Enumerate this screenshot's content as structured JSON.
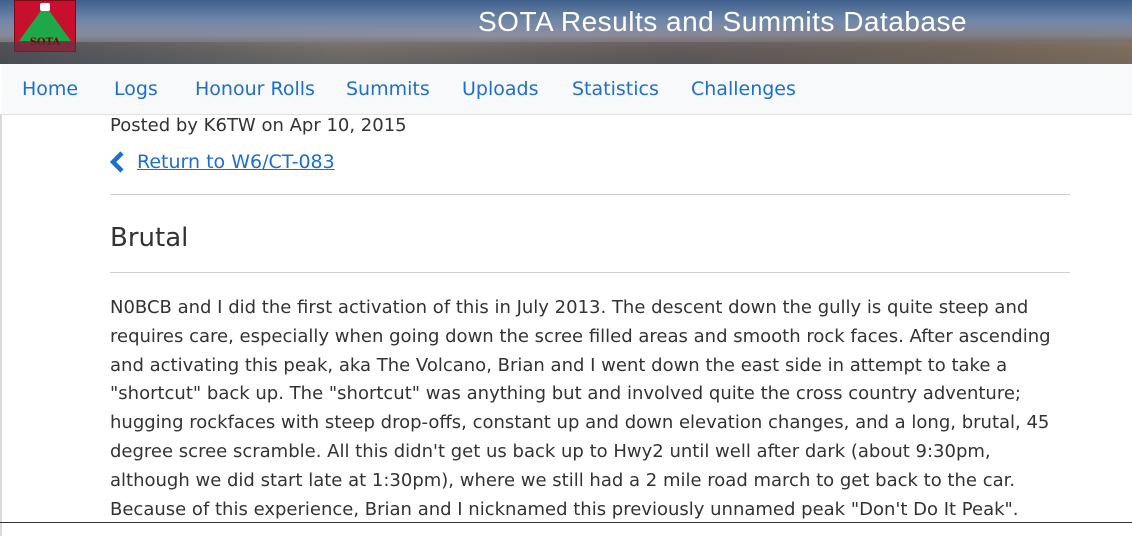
{
  "site": {
    "logo_text": "SOTA",
    "title": "SOTA Results and Summits Database"
  },
  "nav": {
    "items": [
      {
        "label": "Home"
      },
      {
        "label": "Logs"
      },
      {
        "label": "Honour Rolls"
      },
      {
        "label": "Summits"
      },
      {
        "label": "Uploads"
      },
      {
        "label": "Statistics"
      },
      {
        "label": "Challenges"
      }
    ]
  },
  "post": {
    "posted_by": "Posted by K6TW on Apr 10, 2015",
    "back_icon": "chevron-left-icon",
    "back_link": "Return to W6/CT-083",
    "title": "Brutal",
    "body": "N0BCB and I did the first activation of this in July 2013. The descent down the gully is quite steep and requires care, especially when going down the scree filled areas and smooth rock faces. After ascending and activating this peak, aka The Volcano, Brian and I went down the east side in attempt to take a \"shortcut\" back up. The \"shortcut\" was anything but and involved quite the cross country adventure; hugging rockfaces with steep drop-offs, constant up and down elevation changes, and a long, brutal, 45 degree scree scramble. All this didn't get us back up to Hwy2 until well after dark (about 9:30pm, although we did start late at 1:30pm), where we still had a 2 mile road march to get back to the car. Because of this experience, Brian and I nicknamed this previously unnamed peak \"Don't Do It Peak\"."
  },
  "colors": {
    "link": "#1a6fd0",
    "text": "#333333",
    "logo_red": "#c8102e",
    "logo_green": "#1fa84a"
  }
}
